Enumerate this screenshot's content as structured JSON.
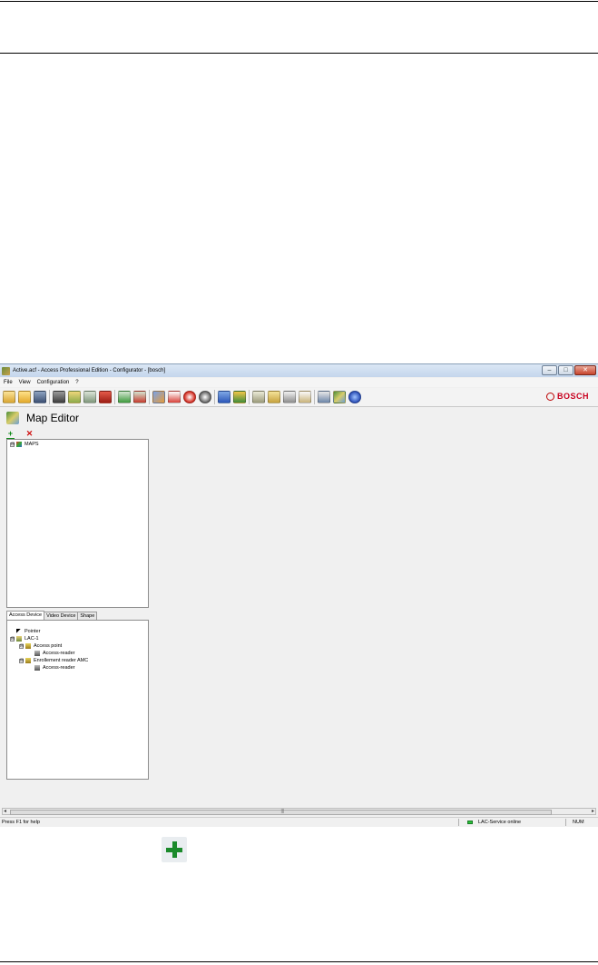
{
  "window": {
    "title": "Active.acf - Access Professional Edition - Configurator - [bosch]",
    "controls": {
      "minimize": "–",
      "maximize": "□",
      "close": "✕"
    }
  },
  "menu": [
    "File",
    "View",
    "Configuration",
    "?"
  ],
  "toolbar": {
    "buttons": [
      "new-config-icon",
      "open-icon",
      "save-icon",
      "devices-icon",
      "controller-icon",
      "reader-icon",
      "door-icon",
      "upload-icon",
      "download-icon",
      "area-icon",
      "card-icon",
      "holiday-icon",
      "timemodel-icon",
      "persons-icon",
      "groups-icon",
      "list-icon",
      "report-icon",
      "print-icon",
      "badge-icon",
      "network-icon",
      "map-editor-icon",
      "help-icon"
    ],
    "brand": "BOSCH"
  },
  "map_editor": {
    "title": "Map Editor",
    "add_symbol": "+",
    "delete_symbol": "✕",
    "maps_tree": [
      {
        "label": "MAPS",
        "expander": "⊟"
      }
    ],
    "tabs": [
      "Access Device",
      "Video Device",
      "Shape"
    ],
    "active_tab": "Access Device",
    "device_tree": [
      {
        "label": "Pointer"
      },
      {
        "label": "LAC-1",
        "expander": "⊟"
      },
      {
        "label": "Access point",
        "expander": "⊟"
      },
      {
        "label": "Access-reader"
      },
      {
        "label": "Enrollement reader AMC",
        "expander": "⊟"
      },
      {
        "label": "Access-reader"
      }
    ]
  },
  "scrollbar": {
    "left_arrow": "◂",
    "right_arrow": "▸",
    "grip": "|||"
  },
  "status": {
    "help": "Press F1 for help",
    "service": "LAC-Service online",
    "num": "NUM"
  },
  "colors": {
    "accent_green": "#1b8a2b",
    "bosch_red": "#c8001e",
    "status_led": "#29c23a"
  }
}
